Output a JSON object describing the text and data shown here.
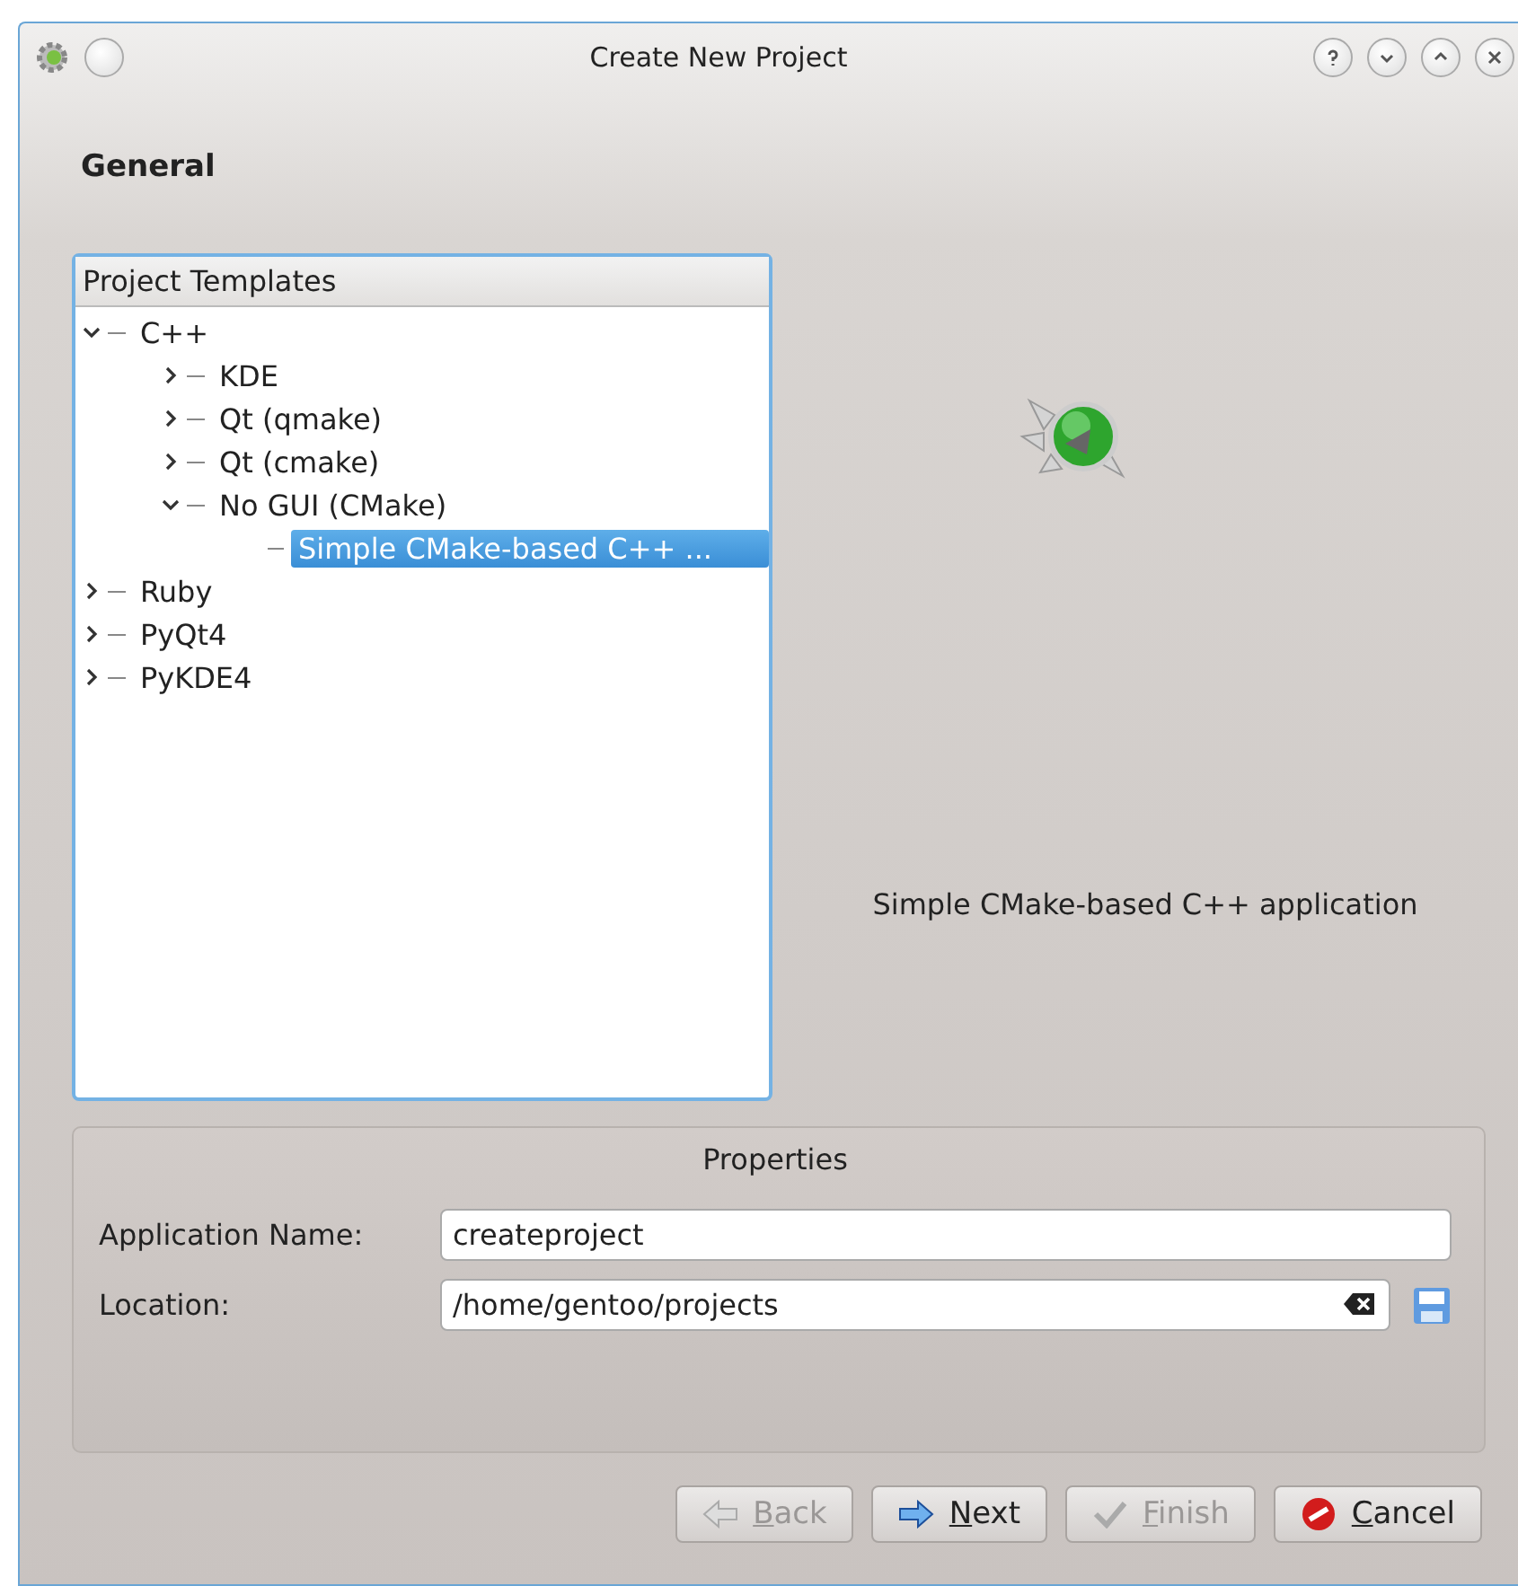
{
  "window": {
    "title": "Create New Project"
  },
  "page_title": "General",
  "templates": {
    "header": "Project Templates",
    "items": [
      {
        "label": "C++",
        "expanded": true,
        "selected": false,
        "children": [
          {
            "label": "KDE",
            "expanded": false,
            "selected": false
          },
          {
            "label": "Qt (qmake)",
            "expanded": false,
            "selected": false
          },
          {
            "label": "Qt (cmake)",
            "expanded": false,
            "selected": false
          },
          {
            "label": "No GUI (CMake)",
            "expanded": true,
            "selected": false,
            "children": [
              {
                "label": "Simple CMake-based C++ ...",
                "selected": true
              }
            ]
          }
        ]
      },
      {
        "label": "Ruby",
        "expanded": false,
        "selected": false
      },
      {
        "label": "PyQt4",
        "expanded": false,
        "selected": false
      },
      {
        "label": "PyKDE4",
        "expanded": false,
        "selected": false
      }
    ]
  },
  "description": "Simple CMake-based C++ application",
  "properties": {
    "title": "Properties",
    "fields": [
      {
        "label": "Application Name:",
        "value": "createproject",
        "kind": "text"
      },
      {
        "label": "Location:",
        "value": "/home/gentoo/projects",
        "kind": "path"
      }
    ]
  },
  "buttons": [
    {
      "label": "Back",
      "kind": "back",
      "disabled": true
    },
    {
      "label": "Next",
      "kind": "next",
      "disabled": false
    },
    {
      "label": "Finish",
      "kind": "finish",
      "disabled": true
    },
    {
      "label": "Cancel",
      "kind": "cancel",
      "disabled": false
    }
  ]
}
